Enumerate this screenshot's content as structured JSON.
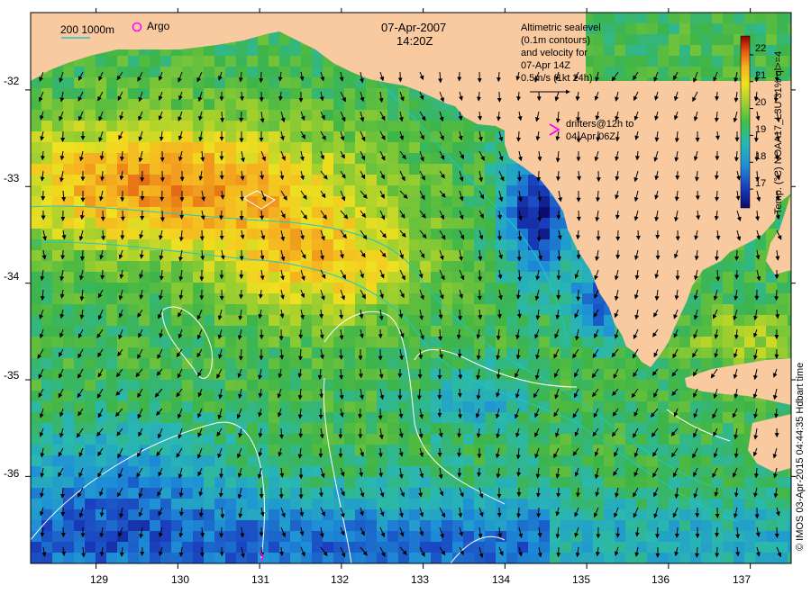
{
  "title": {
    "date": "07-Apr-2007",
    "time": "14:20Z"
  },
  "legend_topleft": {
    "bathy_label": "200  1000m",
    "argo_label": "Argo"
  },
  "altimetry_note": [
    "Altimetric sealevel",
    "(0.1m contours)",
    "and velocity for",
    "07-Apr 14Z",
    "0.5m/s (1kt 24h)"
  ],
  "drifters_note": [
    "drifters@12h to",
    "04-Apr 06Z"
  ],
  "colorbar": {
    "label": "Temp. (°C) NOAA17_L3U 31% ql>=4",
    "ticks": [
      "22",
      "21",
      "20",
      "19",
      "18",
      "17"
    ],
    "min": 16.3,
    "max": 22.7
  },
  "credit": "© IMOS 03-Apr-2015 04:44:35 Hdbart time",
  "axes": {
    "x_ticks": [
      "129",
      "130",
      "131",
      "132",
      "133",
      "134",
      "135",
      "136",
      "137"
    ],
    "y_ticks": [
      "-32",
      "-33",
      "-34",
      "-35",
      "-36"
    ],
    "lon_range": [
      128.2,
      137.5
    ],
    "lat_range": [
      -36.9,
      -31.2
    ]
  },
  "colors": {
    "land": "#f9c9a0",
    "sst_warm": "#f2c830",
    "sst_mid": "#3fb548",
    "sst_cool": "#2c7fc0",
    "sst_cold": "#0a1a80",
    "contour": "#ffffff",
    "bathymetry": "#1cc8c8",
    "drifter": "#ff00ff",
    "arrow": "#000000"
  }
}
